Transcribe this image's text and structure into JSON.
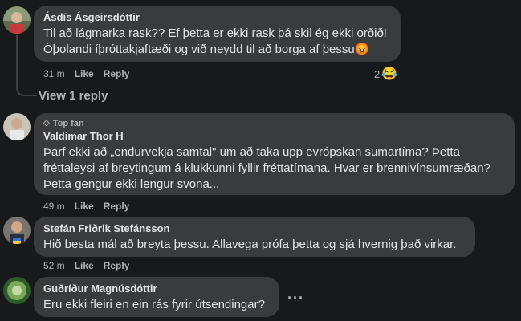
{
  "comments": [
    {
      "author": "Ásdís Ásgeirsdóttir",
      "text": "Til að lágmarka rask?? Ef þetta er ekki rask þá skil ég ekki orðið!\nÓþolandi íþróttakjaftæði og við neydd til að borga af þessu",
      "emoji": "😡",
      "time": "31 m",
      "like": "Like",
      "reply": "Reply",
      "reaction_count": "2",
      "reaction_emoji": "😂"
    },
    {
      "badge": "Top fan",
      "author": "Valdimar Thor H",
      "text": "Þarf ekki að „endurvekja samtal\" um að taka upp evrópskan sumartíma? Þetta\nfréttaleysi af breytingum á klukkunni fyllir fréttatímana. Hvar er brennivínsumræðan?\nÞetta gengur ekki lengur svona...",
      "time": "49 m",
      "like": "Like",
      "reply": "Reply"
    },
    {
      "author": "Stefán Friðrik Stefánsson",
      "text": "Hið besta mál að breyta þessu. Allavega prófa þetta og sjá hvernig það virkar.",
      "time": "52 m",
      "like": "Like",
      "reply": "Reply"
    },
    {
      "author": "Guðríður Magnúsdóttir",
      "text": "Eru ekki fleiri en ein rás fyrir útsendingar?",
      "more": "···"
    }
  ],
  "view_replies": "View 1 reply",
  "colors": {
    "background": "#18191a",
    "bubble": "#3a3b3c",
    "text": "#e4e6eb",
    "secondary": "#b0b3b8"
  }
}
